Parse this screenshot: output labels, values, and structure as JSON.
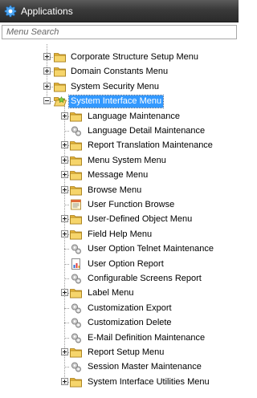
{
  "window": {
    "title": "Applications",
    "icon": "gear-icon"
  },
  "search": {
    "placeholder": "Menu Search"
  },
  "tree": {
    "items": [
      {
        "label": "Corporate Structure Setup Menu",
        "icon": "folder-icon",
        "expandable": true,
        "expanded": false,
        "depth": 0
      },
      {
        "label": "Domain Constants Menu",
        "icon": "folder-icon",
        "expandable": true,
        "expanded": false,
        "depth": 0
      },
      {
        "label": "System Security Menu",
        "icon": "folder-icon",
        "expandable": true,
        "expanded": false,
        "depth": 0
      },
      {
        "label": "System Interface Menu",
        "icon": "folder-open-icon",
        "expandable": true,
        "expanded": true,
        "selected": true,
        "depth": 0
      },
      {
        "label": "Language Maintenance",
        "icon": "folder-icon",
        "expandable": true,
        "expanded": false,
        "depth": 1
      },
      {
        "label": "Language Detail Maintenance",
        "icon": "program-icon",
        "expandable": false,
        "depth": 1
      },
      {
        "label": "Report Translation Maintenance",
        "icon": "folder-icon",
        "expandable": true,
        "expanded": false,
        "depth": 1
      },
      {
        "label": "Menu System Menu",
        "icon": "folder-icon",
        "expandable": true,
        "expanded": false,
        "depth": 1
      },
      {
        "label": "Message Menu",
        "icon": "folder-icon",
        "expandable": true,
        "expanded": false,
        "depth": 1
      },
      {
        "label": "Browse Menu",
        "icon": "folder-icon",
        "expandable": true,
        "expanded": false,
        "depth": 1
      },
      {
        "label": "User Function Browse",
        "icon": "browse-icon",
        "expandable": false,
        "depth": 1
      },
      {
        "label": "User-Defined Object Menu",
        "icon": "folder-icon",
        "expandable": true,
        "expanded": false,
        "depth": 1
      },
      {
        "label": "Field Help Menu",
        "icon": "folder-icon",
        "expandable": true,
        "expanded": false,
        "depth": 1
      },
      {
        "label": "User Option Telnet Maintenance",
        "icon": "program-icon",
        "expandable": false,
        "depth": 1
      },
      {
        "label": "User Option Report",
        "icon": "report-icon",
        "expandable": false,
        "depth": 1
      },
      {
        "label": "Configurable Screens Report",
        "icon": "program-icon",
        "expandable": false,
        "depth": 1
      },
      {
        "label": "Label Menu",
        "icon": "folder-icon",
        "expandable": true,
        "expanded": false,
        "depth": 1
      },
      {
        "label": "Customization Export",
        "icon": "program-icon",
        "expandable": false,
        "depth": 1
      },
      {
        "label": "Customization Delete",
        "icon": "program-icon",
        "expandable": false,
        "depth": 1
      },
      {
        "label": "E-Mail Definition Maintenance",
        "icon": "program-icon",
        "expandable": false,
        "depth": 1
      },
      {
        "label": "Report Setup Menu",
        "icon": "folder-icon",
        "expandable": true,
        "expanded": false,
        "depth": 1
      },
      {
        "label": "Session Master Maintenance",
        "icon": "program-icon",
        "expandable": false,
        "depth": 1
      },
      {
        "label": "System Interface Utilities Menu",
        "icon": "folder-icon",
        "expandable": true,
        "expanded": false,
        "depth": 1
      }
    ]
  },
  "colors": {
    "selection": "#3399ff",
    "folder": "#f3c94a",
    "titlebar": "#3a3a3a"
  }
}
